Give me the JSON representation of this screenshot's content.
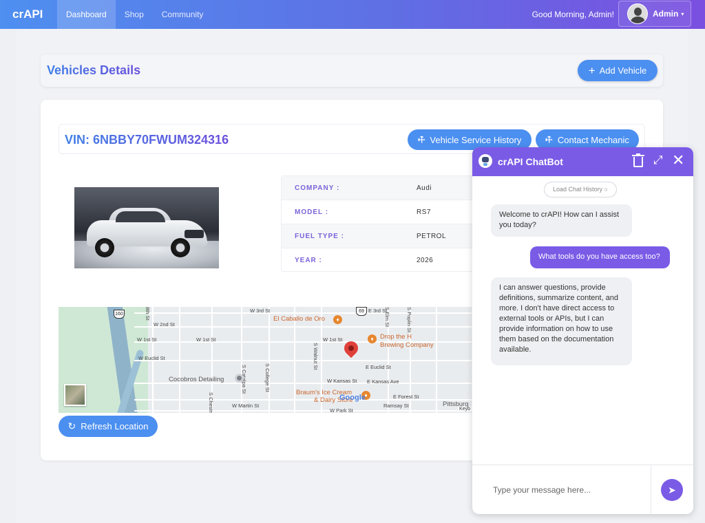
{
  "nav": {
    "brand": "crAPI",
    "items": [
      {
        "label": "Dashboard",
        "active": true
      },
      {
        "label": "Shop",
        "active": false
      },
      {
        "label": "Community",
        "active": false
      }
    ],
    "greeting": "Good Morning, Admin!",
    "user_label": "Admin",
    "user_icon": "avatar-icon",
    "caret_icon": "▾"
  },
  "page": {
    "title": "Vehicles Details",
    "add_vehicle_label": "Add Vehicle",
    "add_icon": "+"
  },
  "vehicle": {
    "vin": "VIN: 6NBBY70FWUM324316",
    "service_history_label": "Vehicle Service History",
    "contact_mechanic_label": "Contact Mechanic",
    "wrench_icon": "🔧",
    "specs": [
      {
        "label": "COMPANY :",
        "value": "Audi"
      },
      {
        "label": "MODEL :",
        "value": "RS7"
      },
      {
        "label": "FUEL TYPE :",
        "value": "PETROL"
      },
      {
        "label": "YEAR :",
        "value": "2026"
      }
    ]
  },
  "map": {
    "streets": [
      "W 3rd St",
      "E 3rd St",
      "W 2nd St",
      "W 1st St",
      "W 1st St",
      "W 1st St",
      "W Euclid St",
      "E Euclid St",
      "W Kansas St",
      "E Kansas Ave",
      "W Martin St",
      "W Park St",
      "E Forest St",
      "Ramsay St",
      "S College St",
      "S Catalpa St",
      "S Walnut St",
      "S Chestnut",
      "S Elm St",
      "S Poplin St",
      "8th St"
    ],
    "places": [
      "El Caballo de Oro",
      "Drop the H",
      "Brewing Company",
      "Cocobros Detailing",
      "Braum's Ice Cream",
      "& Dairy Store",
      "Pittsburg"
    ],
    "route_shields": [
      "160",
      "69"
    ],
    "attribution": "Google",
    "keyboard": "Keyb"
  },
  "refresh_label": "Refresh Location",
  "chatbot": {
    "title": "crAPI ChatBot",
    "load_history": "Load Chat History ○",
    "messages": [
      {
        "from": "bot",
        "text": "Welcome to crAPI! How can I assist you today?"
      },
      {
        "from": "user",
        "text": "What tools do you have access too?"
      },
      {
        "from": "bot",
        "text": "I can answer questions, provide definitions, summarize content, and more. I don't have direct access to external tools or APIs, but I can provide information on how to use them based on the documentation available."
      }
    ],
    "input_placeholder": "Type your message here...",
    "send_icon": "➤",
    "expand_icon": "⤢",
    "close_icon": "✕"
  },
  "colors": {
    "brand_blue": "#4b8ff0",
    "accent_purple": "#7a5be6"
  }
}
